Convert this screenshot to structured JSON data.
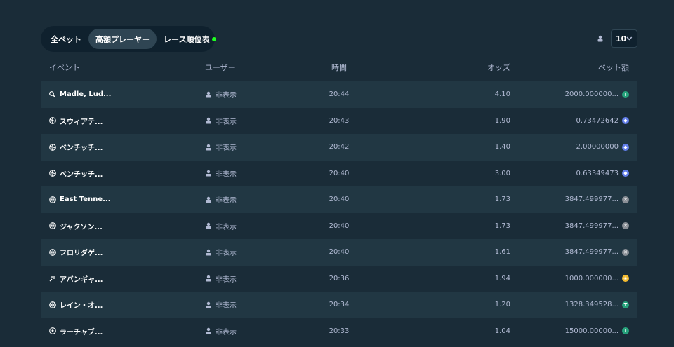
{
  "tabs": [
    {
      "label": "全ベット",
      "active": false
    },
    {
      "label": "高額プレーヤー",
      "active": true
    },
    {
      "label": "レース順位表",
      "active": false,
      "live_dot": true
    }
  ],
  "page_size": {
    "value": "10"
  },
  "headers": {
    "event": "イベント",
    "user": "ユーザー",
    "time": "時間",
    "odds": "オッズ",
    "bet": "ベット額"
  },
  "rows": [
    {
      "sport_icon": "tennis-icon",
      "event": "Madle, Lud...",
      "user": "非表示",
      "time": "20:44",
      "odds": "4.10",
      "bet": "2000.000000...",
      "currency": "usdt",
      "currency_color": "#26a17b"
    },
    {
      "sport_icon": "volleyball-icon",
      "event": "スウィアテ...",
      "user": "非表示",
      "time": "20:43",
      "odds": "1.90",
      "bet": "0.73472642",
      "currency": "eth",
      "currency_color": "#627eea"
    },
    {
      "sport_icon": "volleyball-icon",
      "event": "ベンチッチ...",
      "user": "非表示",
      "time": "20:42",
      "odds": "1.40",
      "bet": "2.00000000",
      "currency": "eth",
      "currency_color": "#627eea"
    },
    {
      "sport_icon": "volleyball-icon",
      "event": "ベンチッチ...",
      "user": "非表示",
      "time": "20:40",
      "odds": "3.00",
      "bet": "0.63349473",
      "currency": "eth",
      "currency_color": "#627eea"
    },
    {
      "sport_icon": "basketball-icon",
      "event": "East Tenne...",
      "user": "非表示",
      "time": "20:40",
      "odds": "1.73",
      "bet": "3847.499977...",
      "currency": "xrp",
      "currency_color": "#8a8f96"
    },
    {
      "sport_icon": "basketball-icon",
      "event": "ジャクソン...",
      "user": "非表示",
      "time": "20:40",
      "odds": "1.73",
      "bet": "3847.499977...",
      "currency": "xrp",
      "currency_color": "#8a8f96"
    },
    {
      "sport_icon": "basketball-icon",
      "event": "フロリダゲ...",
      "user": "非表示",
      "time": "20:40",
      "odds": "1.61",
      "bet": "3847.499977...",
      "currency": "xrp",
      "currency_color": "#8a8f96"
    },
    {
      "sport_icon": "esports-icon",
      "event": "アバンギャ...",
      "user": "非表示",
      "time": "20:36",
      "odds": "1.94",
      "bet": "1000.000000...",
      "currency": "bnb",
      "currency_color": "#f3ba2f"
    },
    {
      "sport_icon": "basketball-icon",
      "event": "レイン・オ...",
      "user": "非表示",
      "time": "20:34",
      "odds": "1.20",
      "bet": "1328.349528...",
      "currency": "usdt",
      "currency_color": "#26a17b"
    },
    {
      "sport_icon": "soccer-icon",
      "event": "ラーチャブ...",
      "user": "非表示",
      "time": "20:33",
      "odds": "1.04",
      "bet": "15000.00000...",
      "currency": "usdt",
      "currency_color": "#26a17b"
    }
  ]
}
